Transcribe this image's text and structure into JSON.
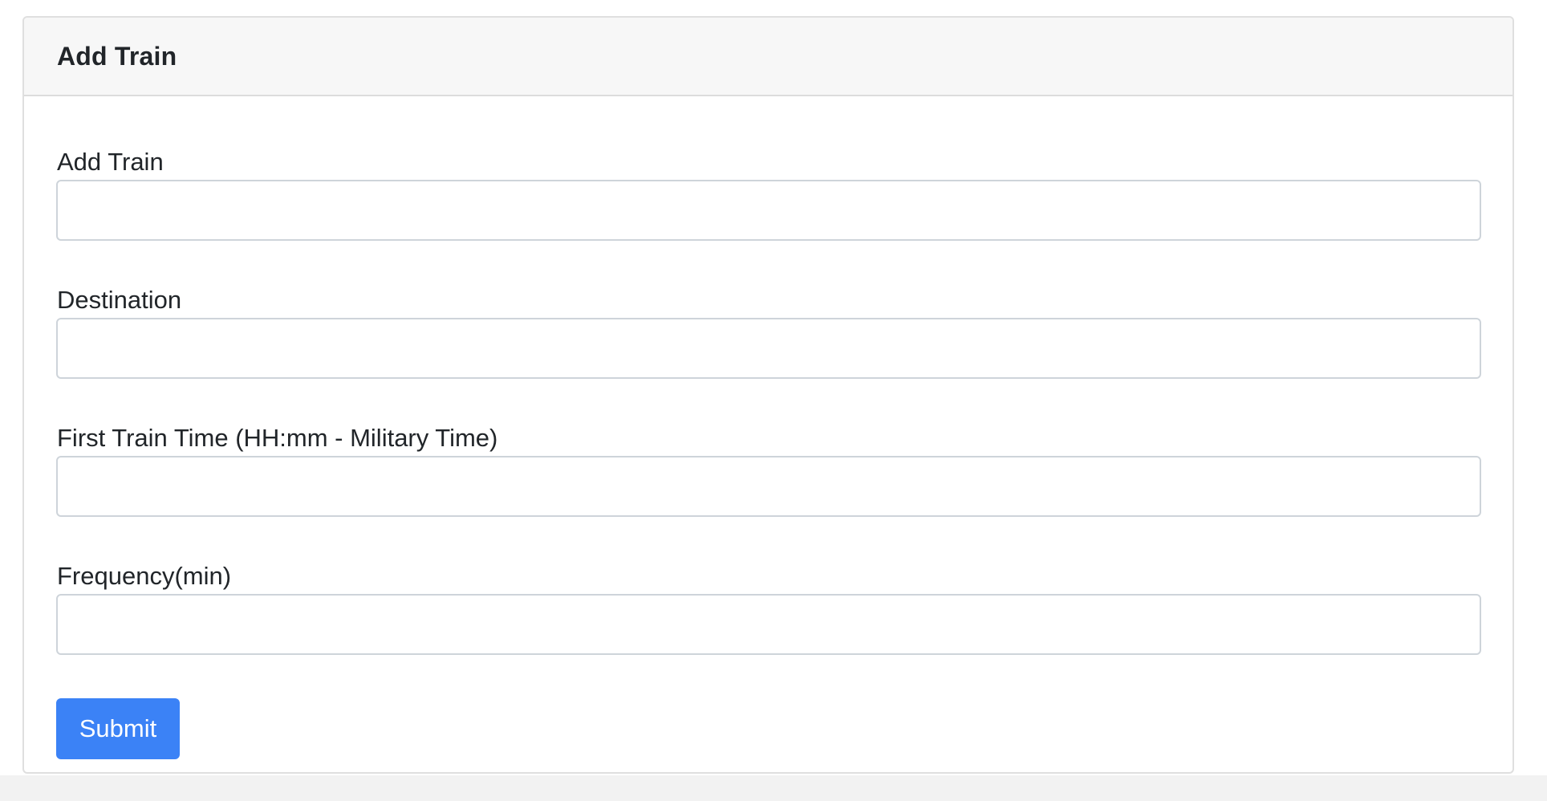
{
  "card": {
    "title": "Add Train"
  },
  "form": {
    "fields": [
      {
        "label": "Add Train",
        "value": "",
        "placeholder": ""
      },
      {
        "label": "Destination",
        "value": "",
        "placeholder": ""
      },
      {
        "label": "First Train Time (HH:mm - Military Time)",
        "value": "",
        "placeholder": ""
      },
      {
        "label": "Frequency(min)",
        "value": "",
        "placeholder": ""
      }
    ],
    "submit_label": "Submit"
  },
  "colors": {
    "primary": "#3b82f6",
    "header_background": "#f7f7f7",
    "border": "#ced4da",
    "text": "#212529"
  }
}
